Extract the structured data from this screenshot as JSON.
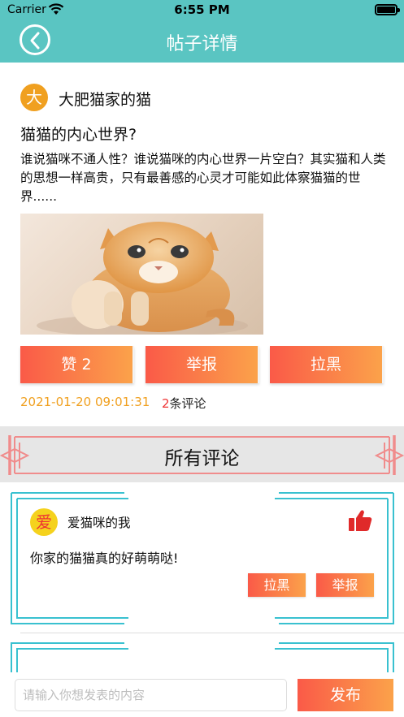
{
  "status_bar": {
    "carrier": "Carrier",
    "time": "6:55 PM"
  },
  "header": {
    "title": "帖子详情",
    "back_icon": "back-circle-icon",
    "bg_color": "#5ac5c2"
  },
  "post": {
    "avatar_char": "大",
    "author": "大肥猫家的猫",
    "title": "猫猫的内心世界?",
    "body": "谁说猫咪不通人性？谁说猫咪的内心世界一片空白？其实猫和人类的思想一样高贵，只有最善感的心灵才可能如此体察猫猫的世界......",
    "image": "kitten-photo",
    "like_label": "赞 2",
    "report_label": "举报",
    "block_label": "拉黑",
    "date": "2021-01-20 09:01:31",
    "comment_count": "2",
    "comment_suffix": "条评论"
  },
  "comments_section": {
    "title": "所有评论"
  },
  "comments": [
    {
      "avatar_char": "爱",
      "user": "爱猫咪的我",
      "text": "你家的猫猫真的好萌萌哒!",
      "block_label": "拉黑",
      "report_label": "举报",
      "like_icon": "thumbs-up-icon"
    }
  ],
  "composer": {
    "placeholder": "请输入你想发表的内容",
    "value": "",
    "submit_label": "发布"
  },
  "colors": {
    "accent_start": "#fa5a48",
    "accent_end": "#fba24a",
    "teal": "#5ac5c2",
    "date": "#f0a020",
    "frame": "#39c1d0"
  }
}
